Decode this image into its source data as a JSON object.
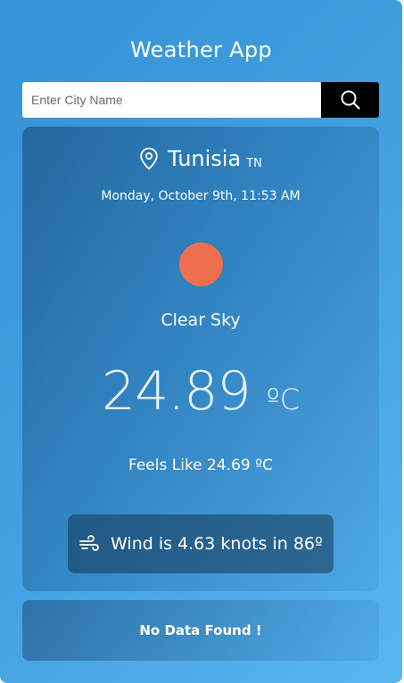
{
  "app": {
    "title": "Weather App"
  },
  "search": {
    "placeholder": "Enter City Name",
    "value": ""
  },
  "weather": {
    "city": "Tunisia",
    "country": "TN",
    "datetime": "Monday, October 9th, 11:53 AM",
    "condition": "Clear Sky",
    "temperature": "24.89",
    "unit": "ºC",
    "feels_like": "Feels Like 24.69 ºC",
    "wind": "Wind is 4.63 knots in 86º"
  },
  "footer": {
    "message": "No Data Found !"
  },
  "colors": {
    "sun": "#ee6f4f",
    "search_button": "#000000",
    "background_start": "#3592d6",
    "background_end": "#5bb6ef"
  }
}
